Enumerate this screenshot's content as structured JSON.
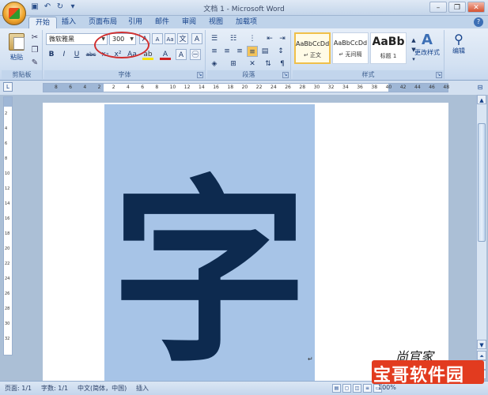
{
  "window": {
    "title": "文档 1 - Microsoft Word",
    "controls": {
      "minimize": "–",
      "restore": "❐",
      "close": "✕"
    }
  },
  "qat": {
    "save_icon": "save-icon",
    "undo_icon": "undo-icon",
    "redo_icon": "redo-icon"
  },
  "tabs": [
    "开始",
    "插入",
    "页面布局",
    "引用",
    "邮件",
    "审阅",
    "视图",
    "加载项"
  ],
  "clipboard": {
    "paste_label": "粘贴",
    "group_label": "剪贴板"
  },
  "font": {
    "name": "微软雅黑",
    "size": "300",
    "group_label": "字体",
    "bold": "B",
    "italic": "I",
    "underline": "U",
    "strike": "abc",
    "subscript": "x₂",
    "superscript": "x²",
    "grow": "A",
    "shrink": "A",
    "clear": "Aa",
    "color": "A",
    "highlight": "ab"
  },
  "paragraph": {
    "group_label": "段落"
  },
  "styles": {
    "group_label": "样式",
    "items": [
      {
        "sample": "AaBbCcDd",
        "name": "↵ 正文"
      },
      {
        "sample": "AaBbCcDd",
        "name": "↵ 无间隔"
      },
      {
        "sample": "AaBb",
        "name": "标题 1"
      }
    ],
    "change_label": "更改样式"
  },
  "editing": {
    "label": "编辑"
  },
  "ruler": {
    "ticks": [
      "8",
      "6",
      "4",
      "2",
      "2",
      "4",
      "6",
      "8",
      "10",
      "12",
      "14",
      "16",
      "18",
      "20",
      "22",
      "24",
      "26",
      "28",
      "30",
      "32",
      "34",
      "36",
      "38",
      "40",
      "42",
      "44",
      "46",
      "48"
    ]
  },
  "vruler": {
    "ticks": [
      "2",
      "4",
      "6",
      "8",
      "10",
      "12",
      "14",
      "16",
      "18",
      "20",
      "22",
      "24",
      "26",
      "28",
      "30",
      "32"
    ]
  },
  "document": {
    "character": "字",
    "paragraph_mark": "↵"
  },
  "status": {
    "page": "页面: 1/1",
    "words": "字数: 1/1",
    "language": "中文(简体，中国)",
    "mode": "插入",
    "zoom": "100%"
  },
  "watermark": {
    "script": "尚官家",
    "brand": "宝哥软件园"
  },
  "colors": {
    "selection": "#a7c4e7",
    "character": "#0d2a4f",
    "highlight_circle": "#d03030"
  }
}
